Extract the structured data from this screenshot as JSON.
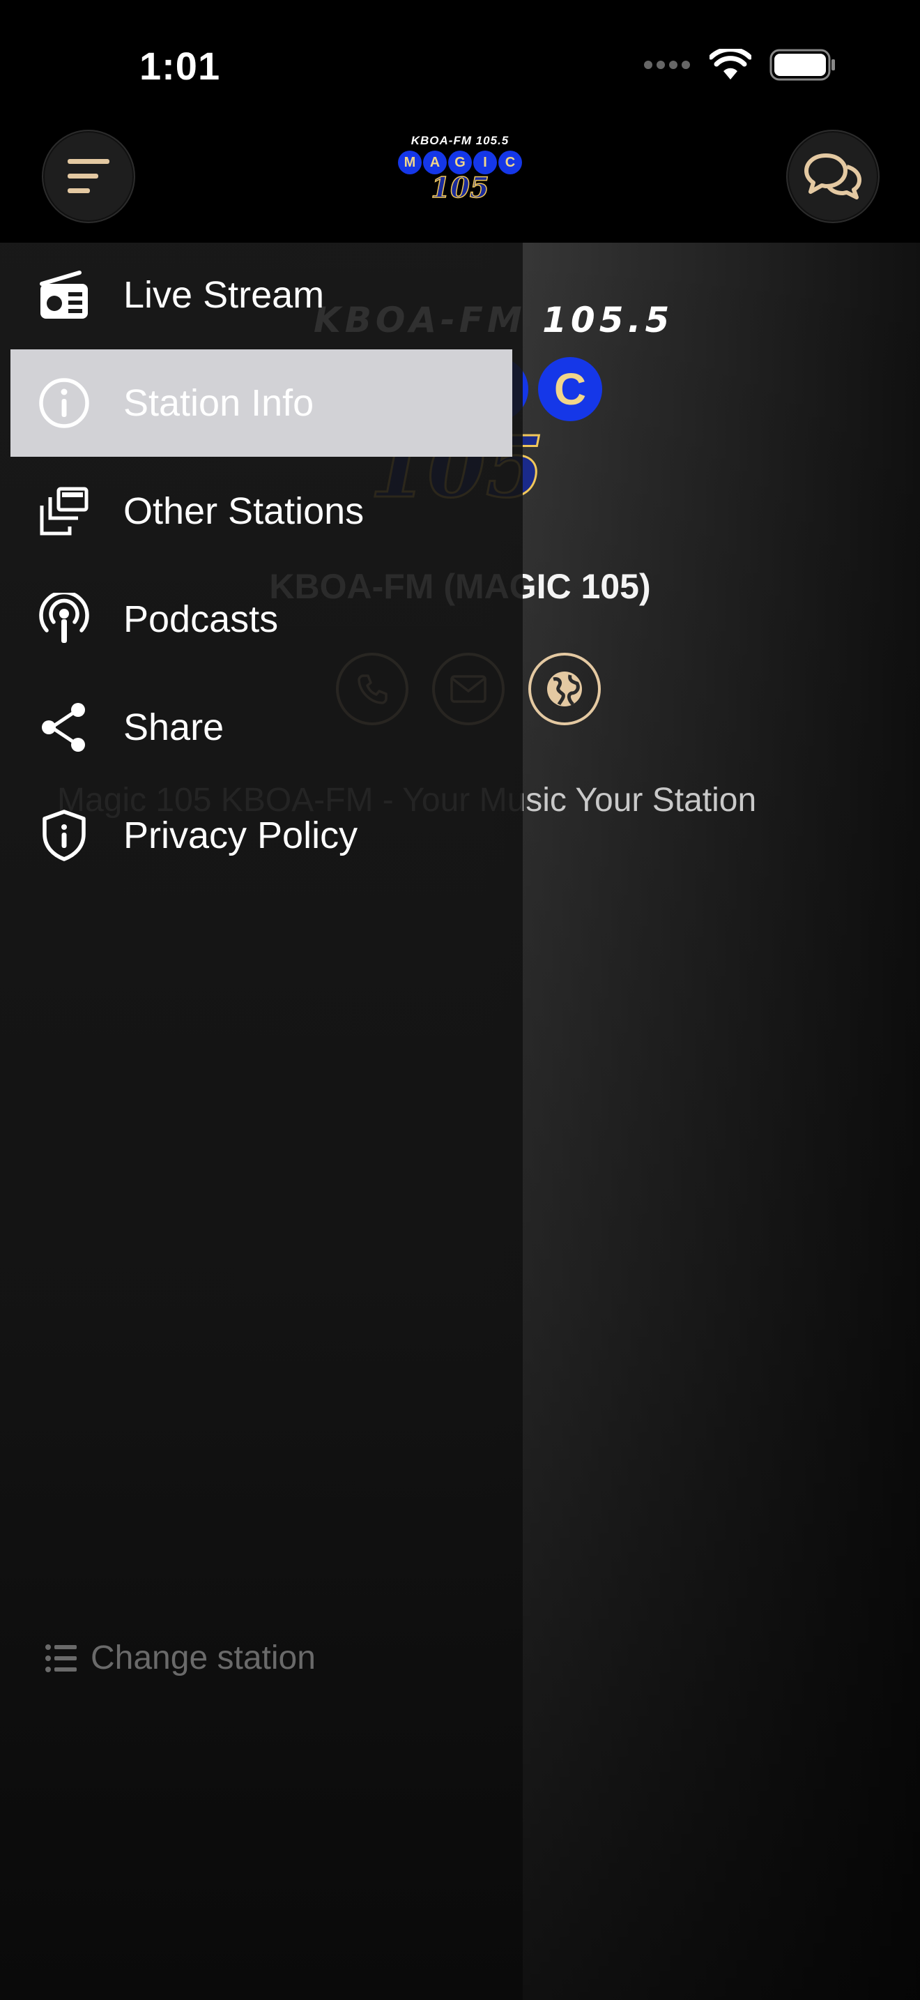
{
  "status_bar": {
    "time": "1:01"
  },
  "header": {
    "menu_button": "menu-icon",
    "chat_button": "chat-icon",
    "logo": {
      "line1": "KBOA-FM 105.5",
      "letters": [
        "M",
        "A",
        "G",
        "I",
        "C"
      ],
      "number": "105"
    }
  },
  "station": {
    "logo_top": "KBOA-FM 105.5",
    "logo_letters_visible": [
      "I",
      "C"
    ],
    "logo_number": "105",
    "title": "KBOA-FM (MAGIC 105)",
    "tagline": "Magic 105 KBOA-FM - Your Music Your Station",
    "contacts": [
      "phone-icon",
      "mail-icon",
      "globe-icon"
    ]
  },
  "drawer": {
    "items": [
      {
        "label": "Live Stream",
        "icon": "radio-icon",
        "selected": false
      },
      {
        "label": "Station Info",
        "icon": "info-icon",
        "selected": true
      },
      {
        "label": "Other Stations",
        "icon": "stations-icon",
        "selected": false
      },
      {
        "label": "Podcasts",
        "icon": "podcast-icon",
        "selected": false
      },
      {
        "label": "Share",
        "icon": "share-icon",
        "selected": false
      },
      {
        "label": "Privacy Policy",
        "icon": "shield-icon",
        "selected": false
      }
    ],
    "change_station": "Change station"
  },
  "colors": {
    "accent": "#e4c9a2",
    "logo_blue": "#1537e8",
    "selected_bg": "#d2d2d6"
  }
}
